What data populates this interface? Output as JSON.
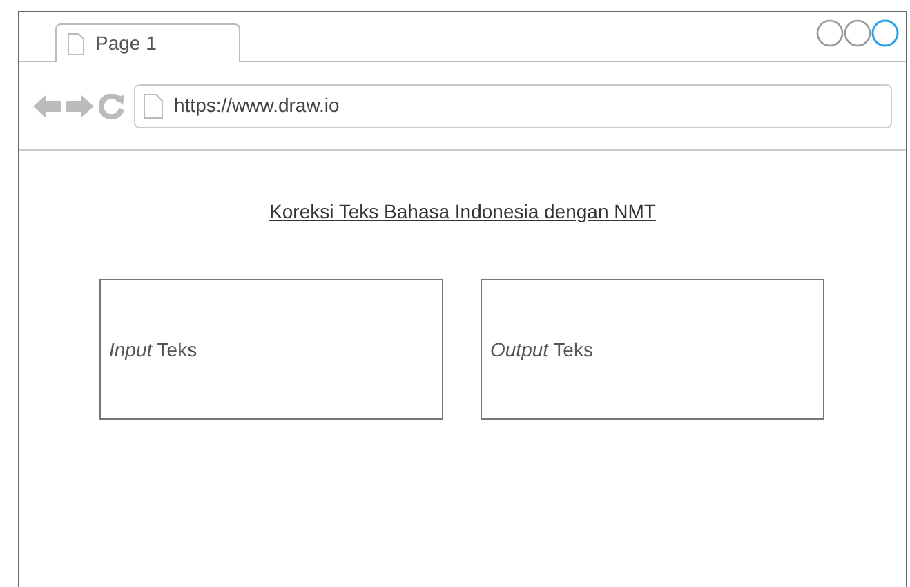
{
  "tab": {
    "label": "Page 1"
  },
  "address_bar": {
    "url": "https://www.draw.io"
  },
  "page": {
    "title": "Koreksi Teks Bahasa Indonesia dengan NMT",
    "panels": [
      {
        "text": "*Input* Teks"
      },
      {
        "text": "*Output* Teks"
      }
    ]
  }
}
